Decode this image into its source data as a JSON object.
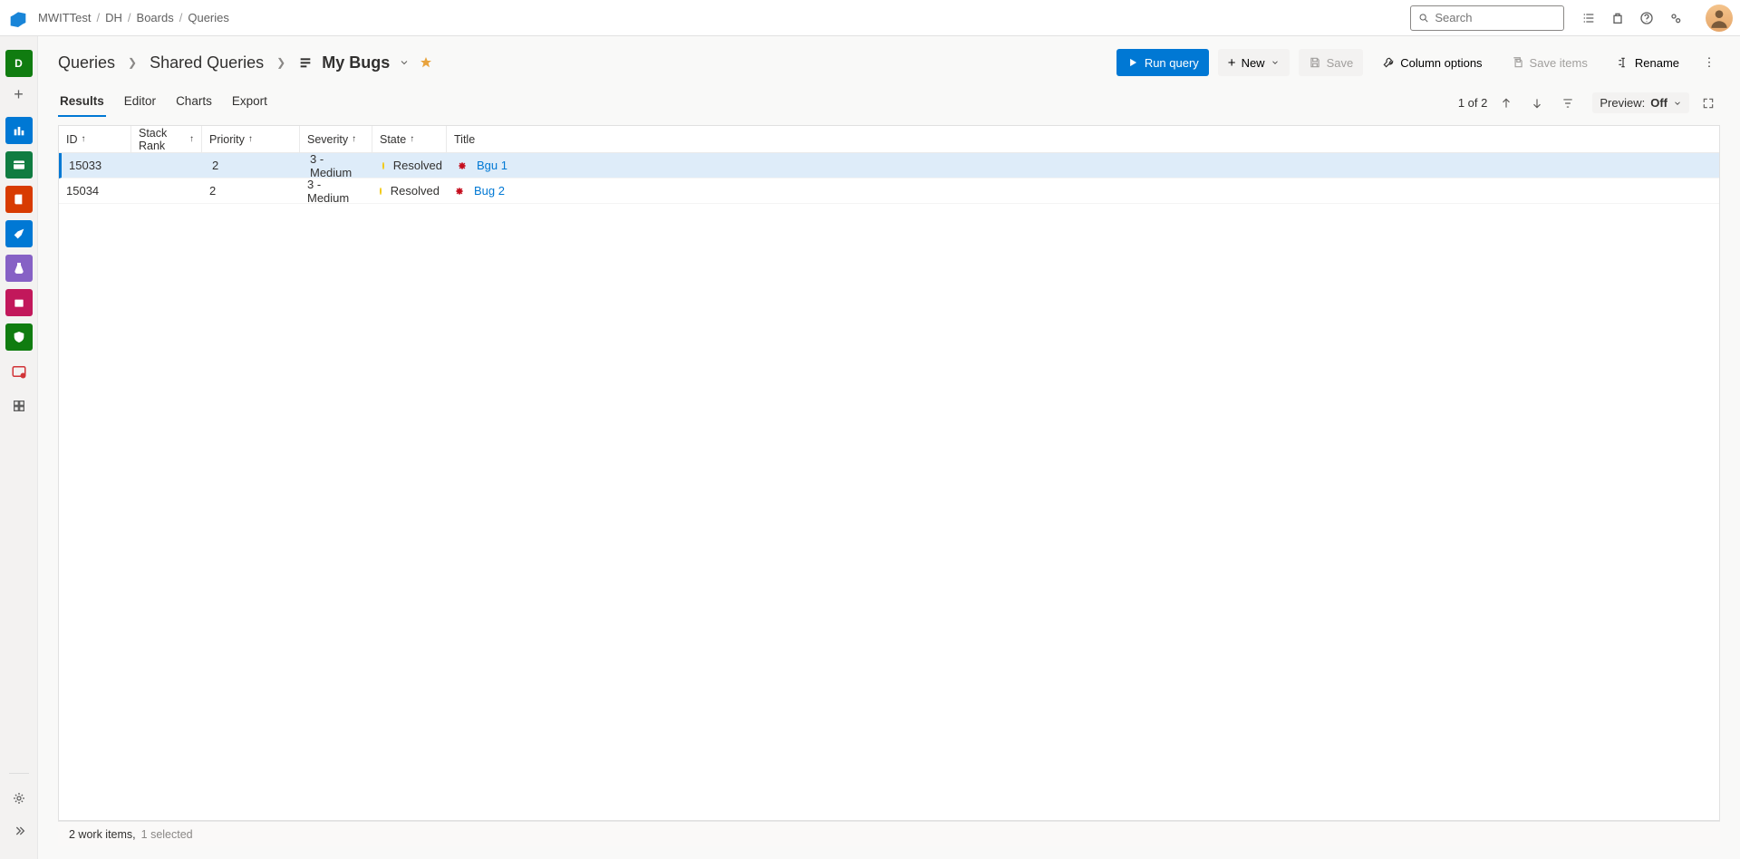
{
  "top": {
    "breadcrumbs": [
      "MWITTest",
      "DH",
      "Boards",
      "Queries"
    ],
    "search_placeholder": "Search"
  },
  "page": {
    "bc": [
      "Queries",
      "Shared Queries"
    ],
    "query_name": "My Bugs",
    "actions": {
      "run_query": "Run query",
      "new": "New",
      "save": "Save",
      "column_options": "Column options",
      "save_items": "Save items",
      "rename": "Rename"
    },
    "tabs": [
      "Results",
      "Editor",
      "Charts",
      "Export"
    ],
    "active_tab": 0,
    "counter": "1 of 2",
    "preview_label": "Preview:",
    "preview_value": "Off"
  },
  "grid": {
    "columns": [
      {
        "label": "ID",
        "sort": "asc"
      },
      {
        "label": "Stack Rank",
        "sort": "asc"
      },
      {
        "label": "Priority",
        "sort": "asc"
      },
      {
        "label": "Severity",
        "sort": "asc"
      },
      {
        "label": "State",
        "sort": "asc"
      },
      {
        "label": "Title",
        "sort": null
      }
    ],
    "rows": [
      {
        "id": "15033",
        "stack": "",
        "priority": "2",
        "severity": "3 - Medium",
        "state": "Resolved",
        "title": "Bgu 1",
        "selected": true
      },
      {
        "id": "15034",
        "stack": "",
        "priority": "2",
        "severity": "3 - Medium",
        "state": "Resolved",
        "title": "Bug 2",
        "selected": false
      }
    ]
  },
  "status": {
    "items_text": "2 work items,",
    "selected_text": "1 selected"
  }
}
